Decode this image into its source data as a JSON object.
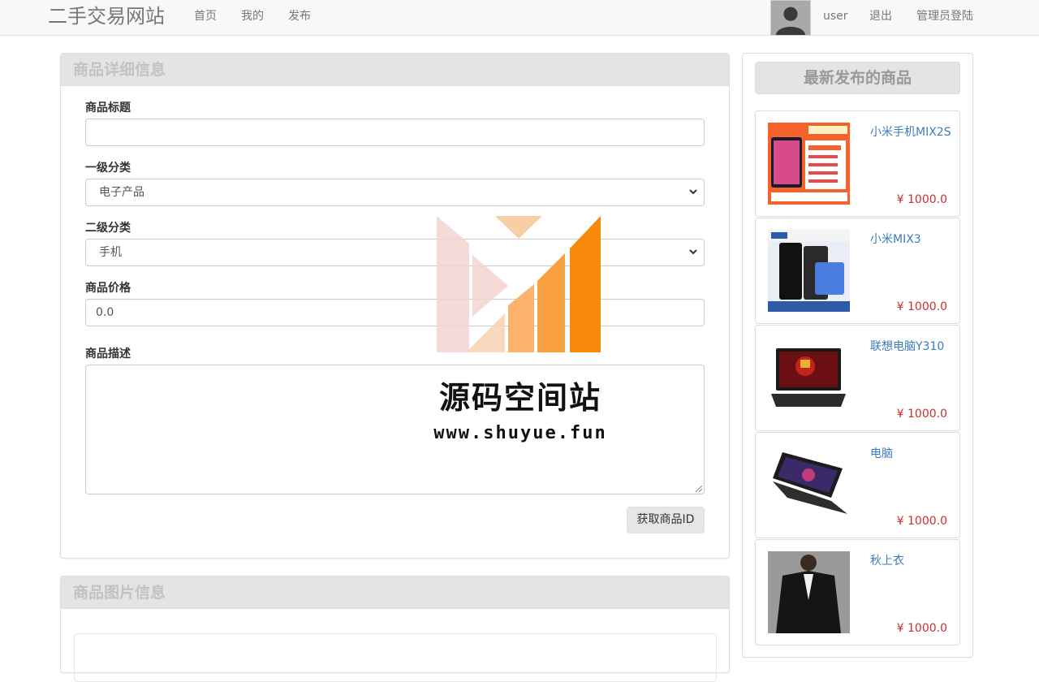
{
  "navbar": {
    "brand": "二手交易网站",
    "links": [
      "首页",
      "我的",
      "发布"
    ],
    "username": "user",
    "logout": "退出",
    "admin_login": "管理员登陆"
  },
  "detail_panel": {
    "heading": "商品详细信息",
    "fields": {
      "title_label": "商品标题",
      "title_value": "",
      "cat1_label": "一级分类",
      "cat1_value": "电子产品",
      "cat2_label": "二级分类",
      "cat2_value": "手机",
      "price_label": "商品价格",
      "price_value": "0.0",
      "desc_label": "商品描述",
      "desc_value": ""
    },
    "get_id_button": "获取商品ID"
  },
  "image_panel": {
    "heading": "商品图片信息"
  },
  "sidebar": {
    "heading": "最新发布的商品",
    "products": [
      {
        "name": "小米手机MIX2S",
        "price": "¥ 1000.0"
      },
      {
        "name": "小米MIX3",
        "price": "¥ 1000.0"
      },
      {
        "name": "联想电脑Y310",
        "price": "¥ 1000.0"
      },
      {
        "name": "电脑",
        "price": "¥ 1000.0"
      },
      {
        "name": "秋上衣",
        "price": "¥ 1000.0"
      }
    ]
  },
  "watermark": {
    "title": "源码空间站",
    "url": "www.shuyue.fun"
  },
  "colors": {
    "link": "#3b7bbf",
    "price": "#c9302c",
    "watermark_orange": "#f7890a"
  }
}
